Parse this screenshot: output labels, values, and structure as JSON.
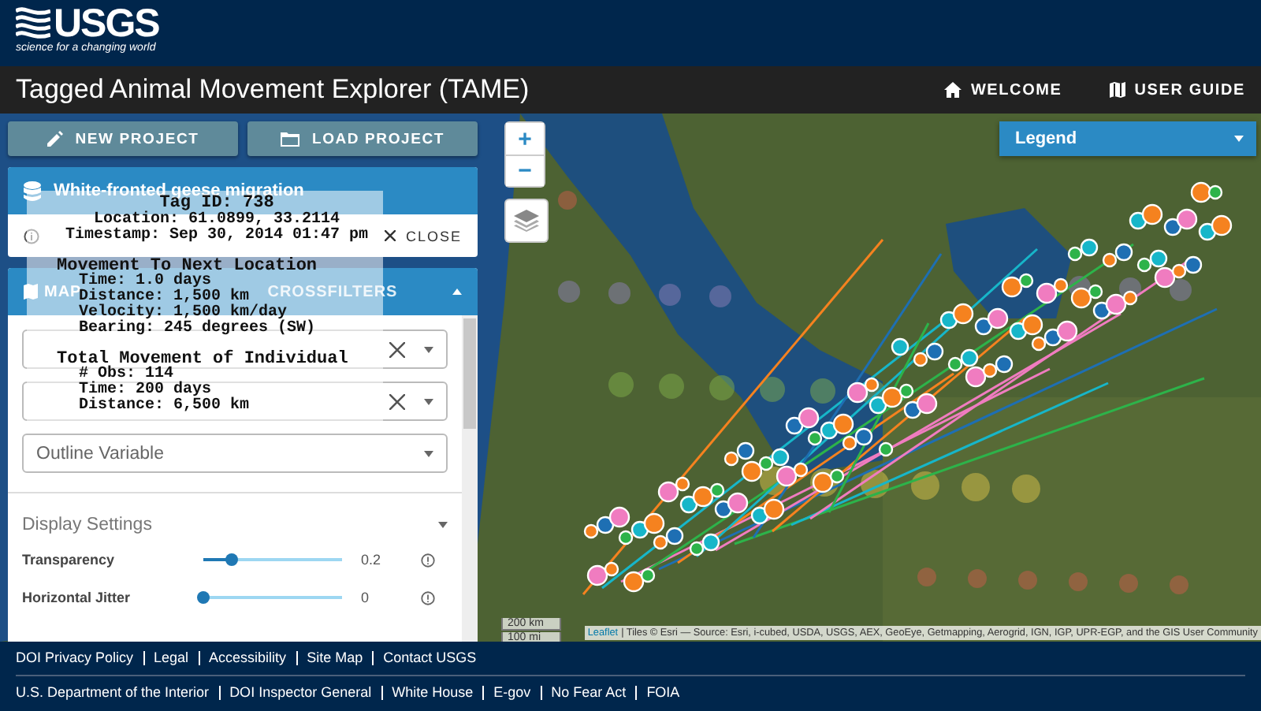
{
  "header": {
    "logo_text": "USGS",
    "tagline": "science for a changing world"
  },
  "app_bar": {
    "title": "Tagged Animal Movement Explorer (TAME)",
    "nav": [
      {
        "label": "WELCOME"
      },
      {
        "label": "USER GUIDE"
      }
    ]
  },
  "sidebar": {
    "buttons": [
      {
        "label": "NEW PROJECT"
      },
      {
        "label": "LOAD PROJECT"
      }
    ],
    "project": {
      "name": "White-fronted geese migration",
      "close": "CLOSE"
    },
    "map_panel": {
      "expanded": true,
      "tabs": [
        {
          "label": "MAP",
          "selected": true
        },
        {
          "label": "CROSSFILTERS",
          "selected": false
        }
      ],
      "fields": [
        {
          "clearable": true
        },
        {
          "clearable": true
        },
        {
          "placeholder": "Outline Variable",
          "clearable": false
        }
      ],
      "display_settings": {
        "title": "Display Settings",
        "expanded": true,
        "sliders": [
          {
            "label": "Transparency",
            "level": 0.2,
            "reading": "0.2"
          },
          {
            "label": "Horizontal Jitter",
            "level": 0,
            "reading": "0"
          }
        ]
      }
    }
  },
  "map": {
    "zoom_in": "+",
    "zoom_out": "−",
    "legend": {
      "label": "Legend",
      "expanded": false
    },
    "scale": [
      "200 km",
      "100 mi"
    ],
    "attribution_link": "Leaflet",
    "attribution": "| Tiles © Esri — Source: Esri, i-cubed, USDA, USGS, AEX, GeoEye, Getmapping, Aerogrid, IGN, IGP, UPR-EGP, and the GIS User Community"
  },
  "tooltip": {
    "title": "Tag ID: 738",
    "lines": [
      "Location: 61.0899, 33.2114",
      "Timestamp: Sep 30, 2014 01:47 pm"
    ],
    "sections": [
      {
        "heading": "Movement To Next Location",
        "lines": [
          "Time: 1.0 days",
          "Distance: 1,500 km",
          "Velocity: 1,500 km/day",
          "Bearing: 245 degrees (SW)"
        ]
      },
      {
        "heading": "Total Movement of Individual",
        "lines": [
          "# Obs: 114",
          "Time: 200 days",
          "Distance: 6,500 km"
        ]
      }
    ]
  },
  "footer": {
    "site_links": [
      "DOI Privacy Policy",
      "Legal",
      "Accessibility",
      "Site Map",
      "Contact USGS"
    ],
    "government_links": [
      "U.S. Department of the Interior",
      "DOI Inspector General",
      "White House",
      "E-gov",
      "No Fear Act",
      "FOIA"
    ]
  }
}
